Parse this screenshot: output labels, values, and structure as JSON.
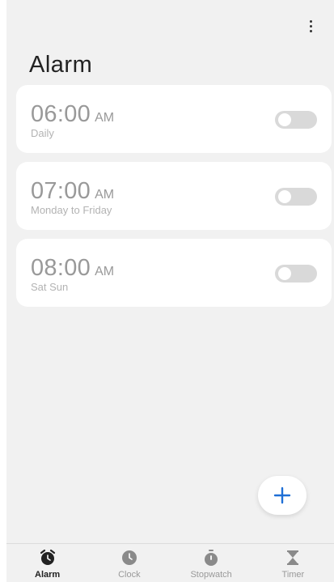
{
  "header": {
    "title": "Alarm",
    "more_icon": "more-vert-icon"
  },
  "alarms": [
    {
      "time": "06:00",
      "ampm": "AM",
      "repeat": "Daily",
      "enabled": false
    },
    {
      "time": "07:00",
      "ampm": "AM",
      "repeat": "Monday to Friday",
      "enabled": false
    },
    {
      "time": "08:00",
      "ampm": "AM",
      "repeat": "Sat Sun",
      "enabled": false
    }
  ],
  "fab": {
    "icon": "plus-icon",
    "color": "#1f6fd6"
  },
  "nav": {
    "items": [
      {
        "label": "Alarm",
        "icon": "alarm-clock-icon",
        "active": true
      },
      {
        "label": "Clock",
        "icon": "clock-icon",
        "active": false
      },
      {
        "label": "Stopwatch",
        "icon": "stopwatch-icon",
        "active": false
      },
      {
        "label": "Timer",
        "icon": "hourglass-icon",
        "active": false
      }
    ]
  },
  "colors": {
    "background": "#f1f1f1",
    "card": "#ffffff",
    "text_primary": "#222222",
    "text_muted": "#999999",
    "toggle_off": "#d9d9d9",
    "accent": "#1f6fd6"
  }
}
